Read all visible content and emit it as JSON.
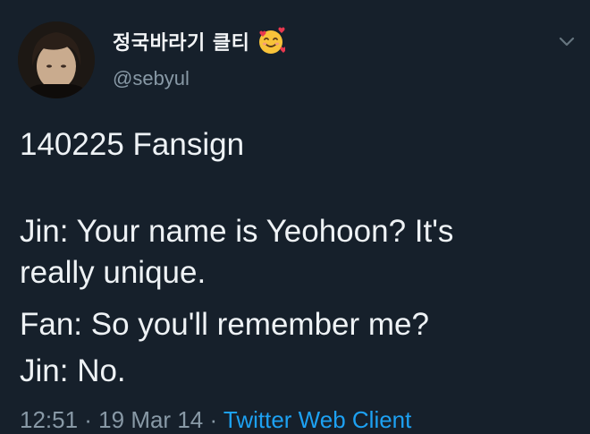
{
  "tweet": {
    "display_name": "정국바라기 클티",
    "handle": "@sebyul",
    "lines": [
      "140225 Fansign",
      "Jin: Your name is Yeohoon? It's",
      "really unique.",
      "Fan: So you'll remember me?",
      "Jin: No."
    ],
    "footer": {
      "timestamp": "12:51 · 19 Mar 14",
      "client": "Twitter Web Client"
    }
  },
  "icons": {
    "display_name_emoji": "smiling-face-with-hearts-emoji",
    "menu": "chevron-down-icon"
  },
  "colors": {
    "background": "#16202b",
    "text": "#eef2f5",
    "secondary": "#8899a6",
    "link": "#1da1f2"
  }
}
